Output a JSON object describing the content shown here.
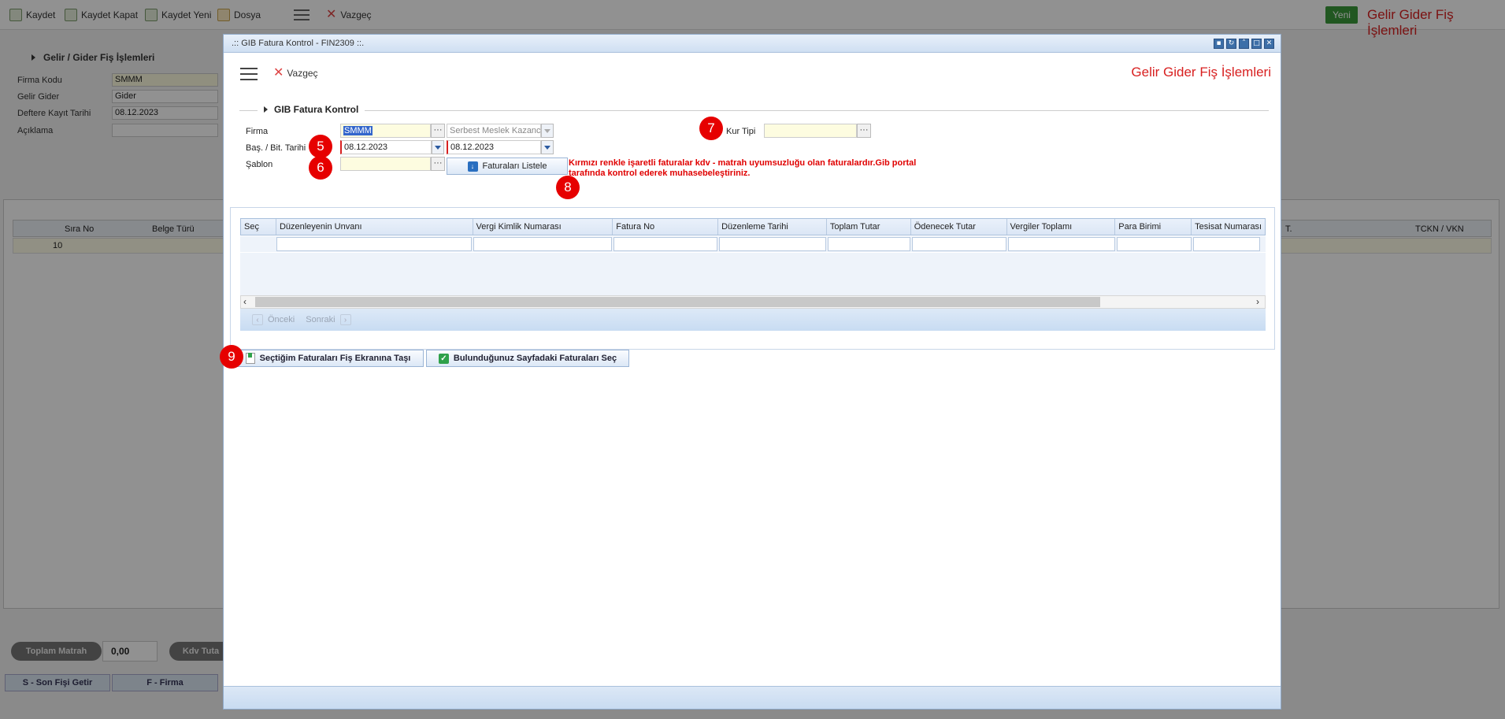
{
  "background": {
    "toolbar": {
      "save": "Kaydet",
      "save_close": "Kaydet Kapat",
      "save_new": "Kaydet Yeni",
      "file": "Dosya",
      "cancel": "Vazgeç",
      "new": "Yeni",
      "title": "Gelir Gider Fiş İşlemleri"
    },
    "section_title": "Gelir / Gider Fiş İşlemleri",
    "form": {
      "firma_label": "Firma Kodu",
      "firma_value": "SMMM",
      "gelir_gider_label": "Gelir Gider",
      "gelir_gider_value": "Gider",
      "deftere_label": "Deftere Kayıt Tarihi",
      "deftere_value": "08.12.2023",
      "aciklama_label": "Açıklama"
    },
    "grid": {
      "columns": [
        "Sıra No",
        "Belge Türü",
        "T.",
        "TCKN / VKN"
      ],
      "row_sira": "10"
    },
    "footer": {
      "toplam_matrah_label": "Toplam Matrah",
      "toplam_matrah_value": "0,00",
      "kdv_label": "Kdv Tuta",
      "son_fis": "S - Son Fişi Getir",
      "firma_btn": "F - Firma"
    }
  },
  "modal": {
    "window_title": ".:: GIB Fatura Kontrol - FIN2309 ::.",
    "cancel": "Vazgeç",
    "header_title": "Gelir Gider Fiş İşlemleri",
    "fieldset_title": "GIB Fatura Kontrol",
    "firma_label": "Firma",
    "firma_code": "SMMM",
    "firma_type": "Serbest Meslek Kazancı",
    "kur_tipi_label": "Kur Tipi",
    "kur_tipi_value": "",
    "date_label": "Baş. / Bit. Tarihi",
    "start_date": "08.12.2023",
    "end_date": "08.12.2023",
    "sablon_label": "Şablon",
    "sablon_value": "",
    "list_button": "Faturaları Listele",
    "warning": "Kırmızı renkle işaretli faturalar kdv - matrah uyumsuzluğu olan faturalardır.Gib portal tarafında kontrol ederek muhasebeleştiriniz.",
    "grid_columns": [
      "Seç",
      "Düzenleyenin Unvanı",
      "Vergi Kimlik Numarası",
      "Fatura No",
      "Düzenleme Tarihi",
      "Toplam Tutar",
      "Ödenecek Tutar",
      "Vergiler Toplamı",
      "Para Birimi",
      "Tesisat Numarası"
    ],
    "pager_prev": "Önceki",
    "pager_next": "Sonraki",
    "move_button": "Seçtiğim Faturaları Fiş Ekranına Taşı",
    "select_page_button": "Bulunduğunuz Sayfadaki Faturaları Seç",
    "markers": [
      "5",
      "6",
      "7",
      "8",
      "9"
    ]
  },
  "colors": {
    "accent_red": "#d82020",
    "marker_red": "#e60000",
    "input_yellow": "#fdfce0"
  }
}
